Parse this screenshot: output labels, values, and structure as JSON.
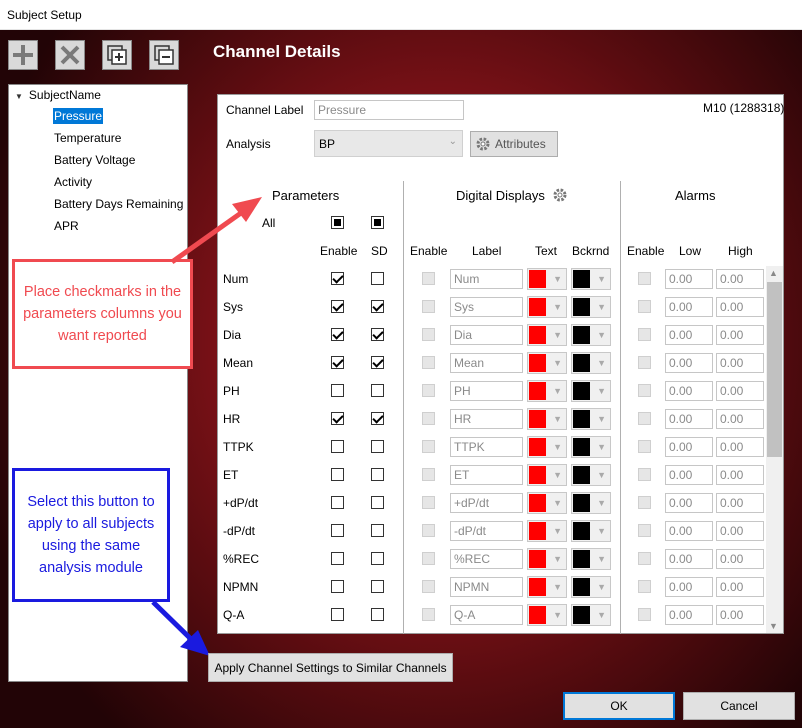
{
  "window": {
    "title": "Subject Setup"
  },
  "toolbar": {
    "add": "add-icon",
    "remove": "delete-icon",
    "expand": "expand-all-icon",
    "collapse": "collapse-all-icon"
  },
  "tree": {
    "root": "SubjectName",
    "items": [
      "Pressure",
      "Temperature",
      "Battery Voltage",
      "Activity",
      "Battery Days Remaining",
      "APR"
    ],
    "selected": 0
  },
  "details": {
    "title": "Channel Details",
    "channel_label_caption": "Channel Label",
    "channel_label_value": "Pressure",
    "device_id": "M10 (1288318)",
    "analysis_caption": "Analysis",
    "analysis_value": "BP",
    "attributes_label": "Attributes"
  },
  "sections": {
    "parameters": "Parameters",
    "digital_displays": "Digital Displays",
    "alarms": "Alarms",
    "all_label": "All"
  },
  "columns": {
    "enable": "Enable",
    "sd": "SD",
    "dd_enable": "Enable",
    "dd_label": "Label",
    "dd_text": "Text",
    "dd_bckrnd": "Bckrnd",
    "al_enable": "Enable",
    "al_low": "Low",
    "al_high": "High"
  },
  "rows": [
    {
      "name": "Num",
      "enable": true,
      "sd": false,
      "low": "0.00",
      "high": "0.00"
    },
    {
      "name": "Sys",
      "enable": true,
      "sd": true,
      "low": "0.00",
      "high": "0.00"
    },
    {
      "name": "Dia",
      "enable": true,
      "sd": true,
      "low": "0.00",
      "high": "0.00"
    },
    {
      "name": "Mean",
      "enable": true,
      "sd": true,
      "low": "0.00",
      "high": "0.00"
    },
    {
      "name": "PH",
      "enable": false,
      "sd": false,
      "low": "0.00",
      "high": "0.00"
    },
    {
      "name": "HR",
      "enable": true,
      "sd": true,
      "low": "0.00",
      "high": "0.00"
    },
    {
      "name": "TTPK",
      "enable": false,
      "sd": false,
      "low": "0.00",
      "high": "0.00"
    },
    {
      "name": "ET",
      "enable": false,
      "sd": false,
      "low": "0.00",
      "high": "0.00"
    },
    {
      "name": "+dP/dt",
      "enable": false,
      "sd": false,
      "low": "0.00",
      "high": "0.00"
    },
    {
      "name": "-dP/dt",
      "enable": false,
      "sd": false,
      "low": "0.00",
      "high": "0.00"
    },
    {
      "name": "%REC",
      "enable": false,
      "sd": false,
      "low": "0.00",
      "high": "0.00"
    },
    {
      "name": "NPMN",
      "enable": false,
      "sd": false,
      "low": "0.00",
      "high": "0.00"
    },
    {
      "name": "Q-A",
      "enable": false,
      "sd": false,
      "low": "0.00",
      "high": "0.00"
    }
  ],
  "colors": {
    "text_color": "#ff0000",
    "background_color": "#000000",
    "callout_red": "#f04a50",
    "callout_blue": "#1a1adf"
  },
  "callouts": {
    "params": "Place checkmarks in the parameters columns you want reported",
    "apply": "Select this button to apply to all subjects using the same analysis module"
  },
  "buttons": {
    "apply": "Apply Channel Settings to Similar Channels",
    "ok": "OK",
    "cancel": "Cancel"
  }
}
